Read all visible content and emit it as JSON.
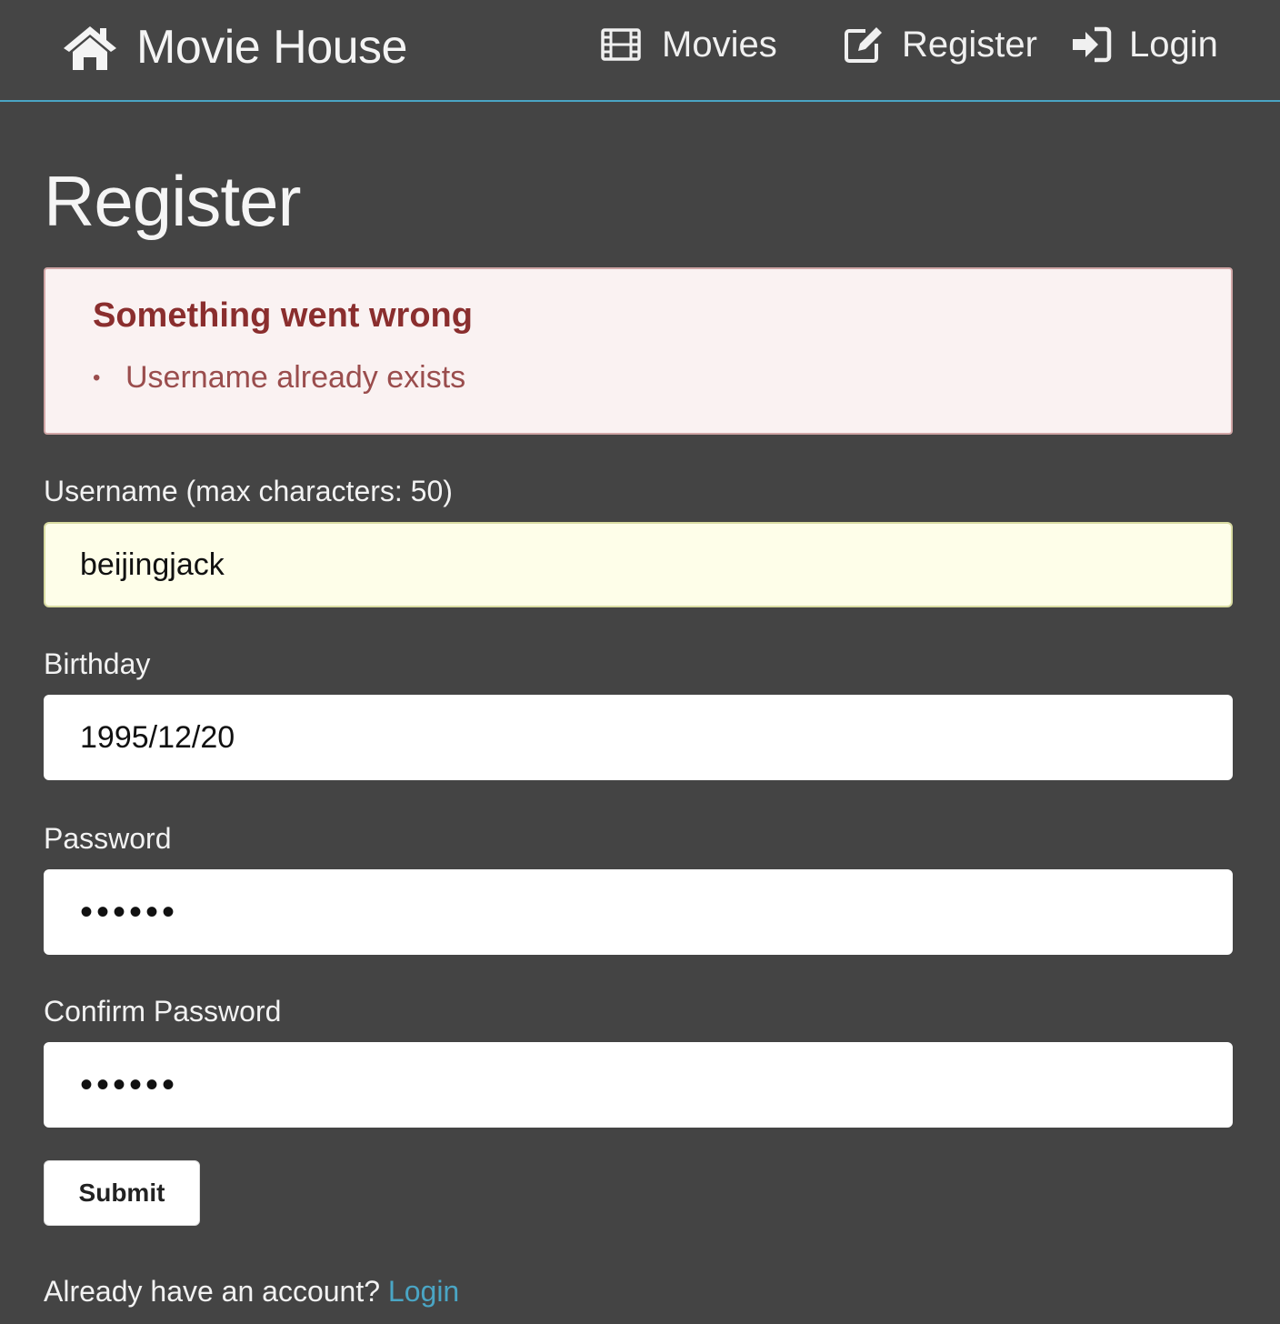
{
  "navbar": {
    "brand": "Movie House",
    "links": [
      {
        "label": "Movies",
        "icon": "film-icon"
      },
      {
        "label": "Register",
        "icon": "edit-icon"
      },
      {
        "label": "Login",
        "icon": "sign-in-icon"
      }
    ],
    "accent_color": "#4aa5c4"
  },
  "page": {
    "title": "Register"
  },
  "alert": {
    "title": "Something went wrong",
    "errors": [
      "Username already exists"
    ],
    "bg_color": "#faf2f2",
    "title_color": "#8a2e2e"
  },
  "form": {
    "username": {
      "label": "Username (max characters: 50)",
      "value": "beijingjack"
    },
    "birthday": {
      "label": "Birthday",
      "value": "1995/12/20"
    },
    "password": {
      "label": "Password",
      "value": "••••••"
    },
    "confirm_password": {
      "label": "Confirm Password",
      "value": "••••••"
    },
    "submit_label": "Submit"
  },
  "footer": {
    "prompt": "Already have an account?",
    "link_label": "Login"
  }
}
